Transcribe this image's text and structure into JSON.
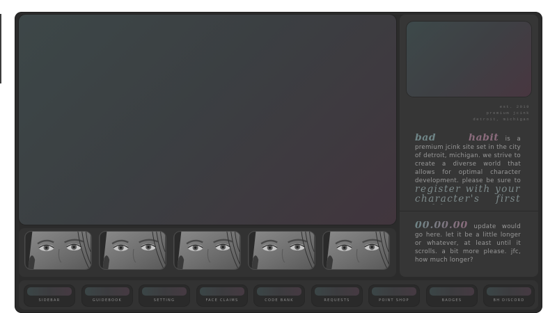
{
  "site": {
    "meta_lines": [
      "est. 2019",
      "premium jcink",
      "detroit, michigan"
    ],
    "brand_word_1": "bad",
    "brand_word_2": "habit",
    "intro_body": "is a premium jcink site set in the city of detroit, michigan. we strive to create a diverse world that allows for optimal character development. please be sure to",
    "intro_cta": "register with your character's first and last name.",
    "update_date": "00.00.00",
    "update_text": "update would go here. let it be a little longer or whatever, at least until it scrolls. a bit more please. jfc, how much longer?"
  },
  "thumbnails": [
    {
      "icon": "portrait-eyes-image"
    },
    {
      "icon": "portrait-eyes-image"
    },
    {
      "icon": "portrait-eyes-image"
    },
    {
      "icon": "portrait-eyes-image"
    },
    {
      "icon": "portrait-eyes-image"
    }
  ],
  "nav": [
    {
      "label": "SIDEBAR"
    },
    {
      "label": "GUIDEBOOK"
    },
    {
      "label": "SETTING"
    },
    {
      "label": "FACE CLAIMS"
    },
    {
      "label": "CODE BANK"
    },
    {
      "label": "REQUESTS"
    },
    {
      "label": "POINT SHOP"
    },
    {
      "label": "BADGES"
    },
    {
      "label": "BH DISCORD"
    }
  ],
  "colors": {
    "frame": "#2b2b2b",
    "accent_teal": "#6f8587",
    "accent_mauve": "#8a6b7c",
    "text": "#9a9a9a"
  }
}
